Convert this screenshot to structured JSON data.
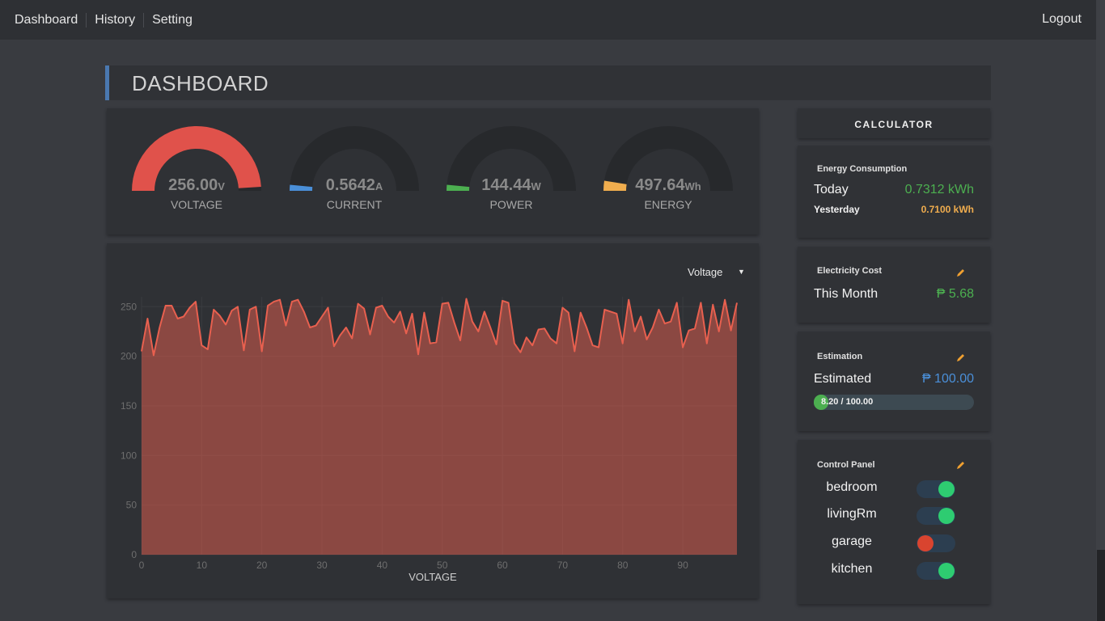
{
  "nav": {
    "items": [
      {
        "label": "Dashboard"
      },
      {
        "label": "History"
      },
      {
        "label": "Setting"
      }
    ],
    "logout_label": "Logout"
  },
  "page": {
    "title": "DASHBOARD"
  },
  "gauges": [
    {
      "value": "256.00",
      "unit": "V",
      "label": "VOLTAGE",
      "fraction": 0.98,
      "color": "#e0524b"
    },
    {
      "value": "0.5642",
      "unit": "A",
      "label": "CURRENT",
      "fraction": 0.03,
      "color": "#4a8fd8"
    },
    {
      "value": "144.44",
      "unit": "W",
      "label": "POWER",
      "fraction": 0.03,
      "color": "#4caf50"
    },
    {
      "value": "497.64",
      "unit": "Wh",
      "label": "ENERGY",
      "fraction": 0.05,
      "color": "#f0ad4e"
    }
  ],
  "chart": {
    "select_label": "Voltage",
    "caret": "▼"
  },
  "chart_data": {
    "type": "area",
    "xlabel": "VOLTAGE",
    "ylabel": "",
    "xlim": [
      0,
      99
    ],
    "ylim": [
      0,
      260
    ],
    "x_ticks": [
      0,
      10,
      20,
      30,
      40,
      50,
      60,
      70,
      80,
      90
    ],
    "y_ticks": [
      0,
      50,
      100,
      150,
      200,
      250
    ],
    "grid": true,
    "series": [
      {
        "color": "#e8604f",
        "values": [
          205,
          238,
          201,
          229,
          251,
          251,
          238,
          240,
          249,
          255,
          211,
          207,
          247,
          241,
          232,
          246,
          250,
          206,
          247,
          250,
          205,
          251,
          255,
          257,
          231,
          255,
          257,
          245,
          229,
          231,
          240,
          249,
          210,
          221,
          229,
          218,
          253,
          248,
          222,
          249,
          251,
          240,
          234,
          245,
          223,
          243,
          202,
          244,
          213,
          214,
          253,
          254,
          234,
          216,
          258,
          235,
          225,
          245,
          229,
          212,
          256,
          254,
          213,
          204,
          219,
          211,
          227,
          228,
          218,
          213,
          249,
          244,
          205,
          244,
          229,
          211,
          209,
          247,
          245,
          243,
          213,
          257,
          225,
          240,
          217,
          229,
          247,
          233,
          235,
          254,
          209,
          226,
          228,
          254,
          213,
          252,
          225,
          257,
          226,
          254
        ]
      }
    ]
  },
  "calculator": {
    "title": "CALCULATOR",
    "energy": {
      "heading": "Energy Consumption",
      "today_label": "Today",
      "today_value": "0.7312 kWh",
      "yesterday_label": "Yesterday",
      "yesterday_value": "0.7100 kWh"
    },
    "cost": {
      "heading": "Electricity Cost",
      "month_label": "This Month",
      "month_value": "₱ 5.68"
    },
    "estimation": {
      "heading": "Estimation",
      "label": "Estimated",
      "value": "₱ 100.00",
      "progress_text": "8.20 / 100.00",
      "progress_fraction": 0.082
    },
    "control": {
      "heading": "Control Panel",
      "switches": [
        {
          "label": "bedroom",
          "on": true
        },
        {
          "label": "livingRm",
          "on": true
        },
        {
          "label": "garage",
          "on": false
        },
        {
          "label": "kitchen",
          "on": true
        }
      ]
    }
  },
  "colors": {
    "accent_blue": "#4a78b0",
    "green": "#4caf50",
    "orange": "#f0ad4e",
    "red": "#e0524b",
    "switch_on": "#2ecc71",
    "switch_off": "#d9442f"
  }
}
